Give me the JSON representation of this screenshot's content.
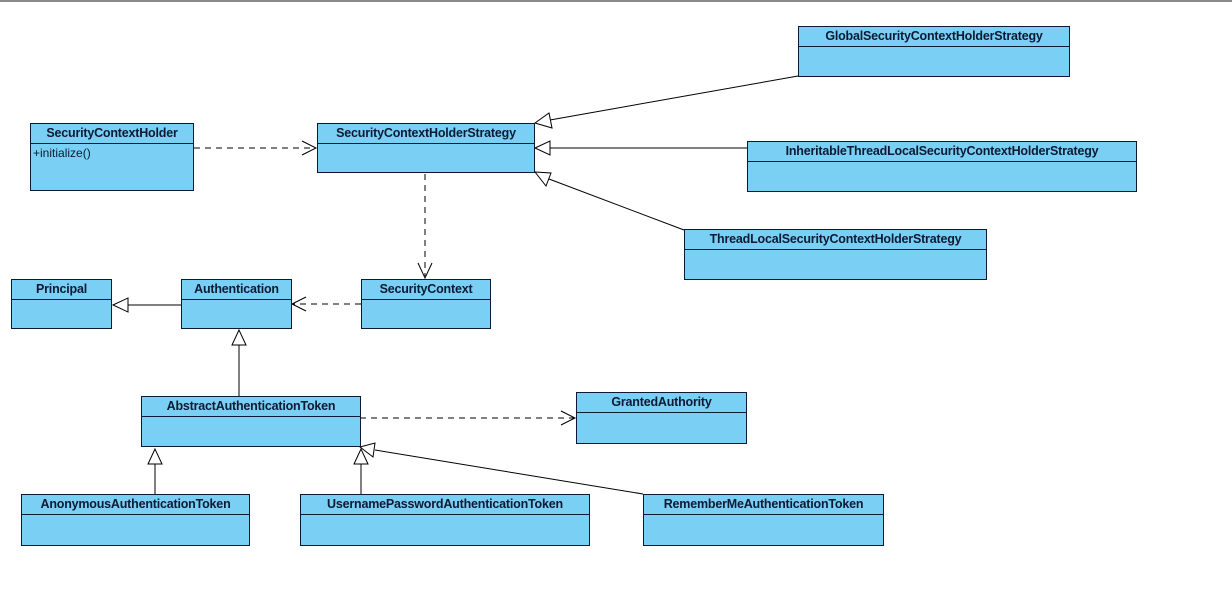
{
  "diagram": {
    "type": "uml-class-diagram",
    "colors": {
      "class_fill": "#7acff5",
      "class_border": "#0d1a33",
      "edge": "#000000",
      "background": "#ffffff"
    },
    "classes": {
      "security_context_holder": {
        "name": "SecurityContextHolder",
        "operations": [
          "+initialize()"
        ]
      },
      "security_context_holder_strategy": {
        "name": "SecurityContextHolderStrategy",
        "operations": []
      },
      "global_strategy": {
        "name": "GlobalSecurityContextHolderStrategy",
        "operations": []
      },
      "inheritable_strategy": {
        "name": "InheritableThreadLocalSecurityContextHolderStrategy",
        "operations": []
      },
      "threadlocal_strategy": {
        "name": "ThreadLocalSecurityContextHolderStrategy",
        "operations": []
      },
      "principal": {
        "name": "Principal",
        "operations": []
      },
      "authentication": {
        "name": "Authentication",
        "operations": []
      },
      "security_context": {
        "name": "SecurityContext",
        "operations": []
      },
      "abstract_auth_token": {
        "name": "AbstractAuthenticationToken",
        "operations": []
      },
      "granted_authority": {
        "name": "GrantedAuthority",
        "operations": []
      },
      "anonymous_auth_token": {
        "name": "AnonymousAuthenticationToken",
        "operations": []
      },
      "username_password_auth_token": {
        "name": "UsernamePasswordAuthenticationToken",
        "operations": []
      },
      "remember_me_auth_token": {
        "name": "RememberMeAuthenticationToken",
        "operations": []
      }
    },
    "relationships": [
      {
        "from": "SecurityContextHolder",
        "to": "SecurityContextHolderStrategy",
        "kind": "dependency"
      },
      {
        "from": "GlobalSecurityContextHolderStrategy",
        "to": "SecurityContextHolderStrategy",
        "kind": "realization"
      },
      {
        "from": "InheritableThreadLocalSecurityContextHolderStrategy",
        "to": "SecurityContextHolderStrategy",
        "kind": "realization"
      },
      {
        "from": "ThreadLocalSecurityContextHolderStrategy",
        "to": "SecurityContextHolderStrategy",
        "kind": "realization"
      },
      {
        "from": "SecurityContextHolderStrategy",
        "to": "SecurityContext",
        "kind": "dependency"
      },
      {
        "from": "SecurityContext",
        "to": "Authentication",
        "kind": "dependency"
      },
      {
        "from": "Authentication",
        "to": "Principal",
        "kind": "generalization"
      },
      {
        "from": "AbstractAuthenticationToken",
        "to": "Authentication",
        "kind": "generalization"
      },
      {
        "from": "AbstractAuthenticationToken",
        "to": "GrantedAuthority",
        "kind": "dependency"
      },
      {
        "from": "AnonymousAuthenticationToken",
        "to": "AbstractAuthenticationToken",
        "kind": "generalization"
      },
      {
        "from": "UsernamePasswordAuthenticationToken",
        "to": "AbstractAuthenticationToken",
        "kind": "generalization"
      },
      {
        "from": "RememberMeAuthenticationToken",
        "to": "AbstractAuthenticationToken",
        "kind": "generalization"
      }
    ]
  }
}
